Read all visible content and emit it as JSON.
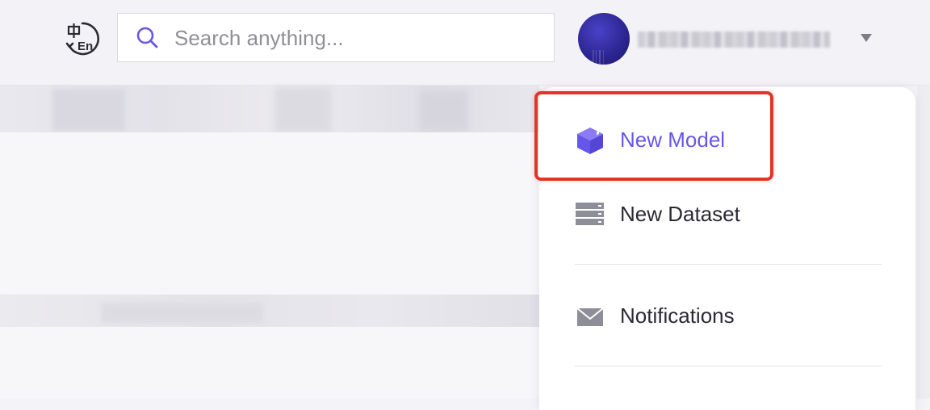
{
  "header": {
    "language_toggle_icon": "zh-en-language-icon",
    "search": {
      "placeholder": "Search anything...",
      "value": "",
      "icon": "search-icon",
      "accent_color": "#6757e8"
    },
    "user": {
      "avatar_icon": "avatar",
      "dropdown_icon": "caret-down-icon"
    }
  },
  "dropdown_menu": {
    "items": [
      {
        "label": "New Model",
        "icon": "cube-icon",
        "active": true,
        "color": "#6757e8"
      },
      {
        "label": "New Dataset",
        "icon": "server-stack-icon",
        "active": false,
        "color": "#2a2a35"
      },
      {
        "label": "Notifications",
        "icon": "envelope-icon",
        "active": false,
        "color": "#2a2a35"
      }
    ]
  },
  "annotation": {
    "highlight_color": "#e0362a"
  }
}
